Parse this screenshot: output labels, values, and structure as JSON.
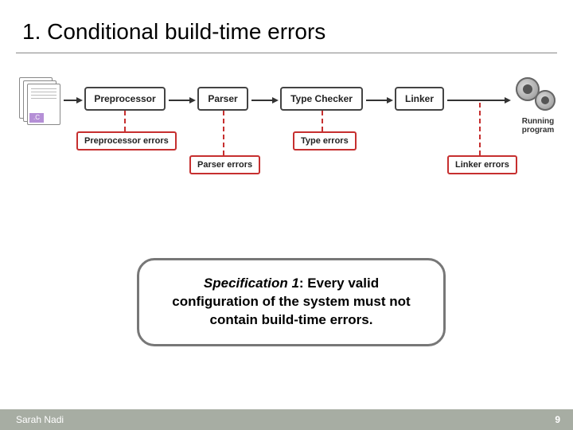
{
  "title": "1. Conditional build-time errors",
  "file_ext": ".C",
  "stages": {
    "preprocessor": "Preprocessor",
    "parser": "Parser",
    "type_checker": "Type Checker",
    "linker": "Linker"
  },
  "running_program": "Running program",
  "errors": {
    "preprocessor": "Preprocessor errors",
    "parser": "Parser errors",
    "type": "Type errors",
    "linker": "Linker errors"
  },
  "spec": {
    "prefix": "Specification 1",
    "rest": ": Every valid configuration of the system must not contain build-time errors."
  },
  "footer": {
    "author": "Sarah Nadi",
    "page": "9"
  },
  "colors": {
    "error_border": "#c62f2f",
    "footer_bg": "#a7ada3"
  }
}
